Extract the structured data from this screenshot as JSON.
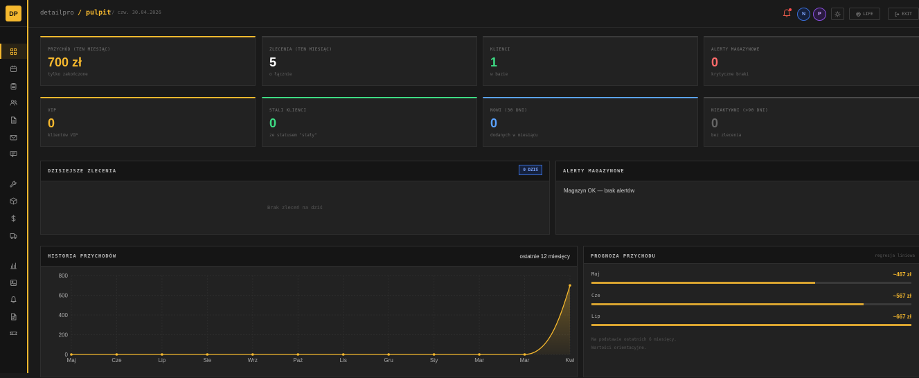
{
  "sidebar": {
    "logo": "DP",
    "items": [
      {
        "icon": "grid-icon",
        "active": true
      },
      {
        "icon": "calendar-icon"
      },
      {
        "icon": "clipboard-icon"
      },
      {
        "icon": "users-icon"
      },
      {
        "icon": "file-icon"
      },
      {
        "icon": "mail-icon"
      },
      {
        "icon": "message-icon"
      },
      {
        "icon": "wrench-icon"
      },
      {
        "icon": "box-icon"
      },
      {
        "icon": "dollar-icon"
      },
      {
        "icon": "truck-icon"
      },
      {
        "icon": "bar-chart-icon"
      },
      {
        "icon": "image-icon"
      },
      {
        "icon": "bell-icon"
      },
      {
        "icon": "document-icon"
      },
      {
        "icon": "ticket-icon"
      }
    ]
  },
  "topbar": {
    "brand": "detailpro",
    "crumb": "/ pulpit",
    "date": "// czw. 30.04.2026",
    "avatars": [
      "N",
      "P"
    ],
    "life_label": "LIFE",
    "exit_label": "EXIT"
  },
  "stats": [
    {
      "label": "PRZYCHÓD (TEN MIESIĄC)",
      "value": "700 zł",
      "sub": "tylko zakończone",
      "color": "#f5b82e",
      "border": "#f5b82e"
    },
    {
      "label": "ZLECENIA (TEN MIESIĄC)",
      "value": "5",
      "sub": "o łącznie",
      "color": "#ffffff",
      "border": "#3a3a3a"
    },
    {
      "label": "KLIENCI",
      "value": "1",
      "sub": "w bazie",
      "color": "#3ddc84",
      "border": "#3a3a3a"
    },
    {
      "label": "ALERTY MAGAZYNOWE",
      "value": "0",
      "sub": "krytyczne braki",
      "color": "#ff6b6b",
      "border": "#3a3a3a"
    },
    {
      "label": "VIP",
      "value": "0",
      "sub": "klientów VIP",
      "color": "#f5b82e",
      "border": "#f5b82e"
    },
    {
      "label": "STALI KLIENCI",
      "value": "0",
      "sub": "ze statusem \"stały\"",
      "color": "#3ddc84",
      "border": "#3ddc84"
    },
    {
      "label": "NOWI (30 DNI)",
      "value": "0",
      "sub": "dodanych w miesiącu",
      "color": "#5aa2ff",
      "border": "#5aa2ff"
    },
    {
      "label": "NIEAKTYWNI (>90 DNI)",
      "value": "0",
      "sub": "bez zlecenia",
      "color": "#666666",
      "border": "#4a4a4a"
    }
  ],
  "today": {
    "title": "DZISIEJSZE ZLECENIA",
    "badge": "0 DZIŚ",
    "empty": "Brak zleceń na dziś"
  },
  "inventory": {
    "title": "ALERTY MAGAZYNOWE",
    "message": "Magazyn OK — brak alertów"
  },
  "history": {
    "title": "HISTORIA PRZYCHODÓW",
    "range": "ostatnie 12 miesięcy"
  },
  "forecast": {
    "title": "PROGNOZA PRZYCHODU",
    "method": "regresja liniowa",
    "rows": [
      {
        "month": "Maj",
        "value": "~467 zł",
        "fill": 0.7
      },
      {
        "month": "Cze",
        "value": "~567 zł",
        "fill": 0.85
      },
      {
        "month": "Lip",
        "value": "~667 zł",
        "fill": 1.0
      }
    ],
    "note1": "Na podstawie ostatnich 6 miesięcy.",
    "note2": "Wartości orientacyjne."
  },
  "chart_data": {
    "type": "line",
    "categories": [
      "Maj",
      "Cze",
      "Lip",
      "Sie",
      "Wrz",
      "Paź",
      "Lis",
      "Gru",
      "Sty",
      "Mar",
      "Mar",
      "Kwi"
    ],
    "series": [
      {
        "values": [
          0,
          0,
          0,
          0,
          0,
          0,
          0,
          0,
          0,
          0,
          0,
          700
        ]
      }
    ],
    "yticks": [
      0,
      200,
      400,
      600,
      800
    ],
    "ylim": [
      0,
      800
    ],
    "color": "#f5b82e",
    "grid": true
  }
}
